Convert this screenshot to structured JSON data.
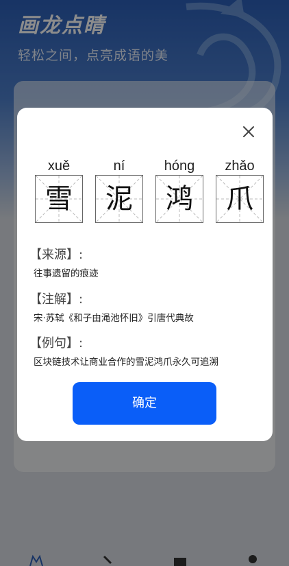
{
  "app": {
    "title": "画龙点睛",
    "subtitle": "轻松之间，点亮成语的美"
  },
  "modal": {
    "characters": [
      {
        "pinyin": "xuě",
        "char": "雪"
      },
      {
        "pinyin": "ní",
        "char": "泥"
      },
      {
        "pinyin": "hóng",
        "char": "鸿"
      },
      {
        "pinyin": "zhǎo",
        "char": "爪"
      }
    ],
    "source_label": "【来源】:",
    "source_text": "往事遗留的痕迹",
    "annotation_label": "【注解】:",
    "annotation_text": "宋·苏轼《和子由渑池怀旧》引唐代典故",
    "example_label": "【例句】:",
    "example_text": "区块链技术让商业合作的雪泥鸿爪永久可追溯",
    "confirm_label": "确定"
  },
  "colors": {
    "accent": "#0a5ef8",
    "header_blue": "#2c5fb8"
  },
  "icons": {
    "close": "close-icon"
  }
}
